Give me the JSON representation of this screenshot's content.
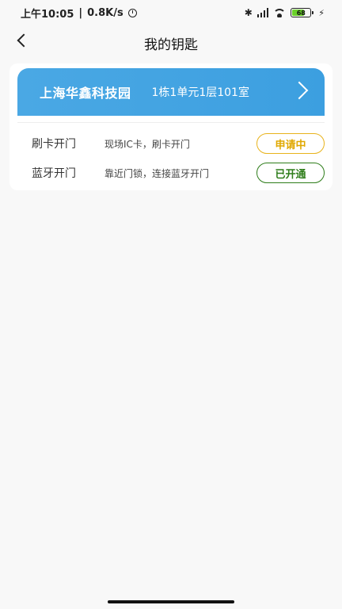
{
  "status_bar": {
    "time": "上午10:05",
    "separator": "|",
    "speed": "0.8K/s",
    "battery_level": "68",
    "battery_percent": 68,
    "icons": [
      "alarm-icon",
      "bluetooth-icon",
      "signal-icon",
      "wifi-icon",
      "battery-icon",
      "charging-icon"
    ]
  },
  "nav": {
    "title": "我的钥匙",
    "back_icon": "chevron-left-icon"
  },
  "key_card": {
    "park_name": "上海华鑫科技园",
    "room": "1栋1单元1层101室",
    "banner_color": "#3c9fe0",
    "arrow_icon": "chevron-right-icon",
    "methods": [
      {
        "name": "刷卡开门",
        "desc": "现场IC卡，刷卡开门",
        "status": "申请中",
        "status_color": "#e0a800"
      },
      {
        "name": "蓝牙开门",
        "desc": "靠近门锁，连接蓝牙开门",
        "status": "已开通",
        "status_color": "#2e7d1a"
      }
    ]
  }
}
